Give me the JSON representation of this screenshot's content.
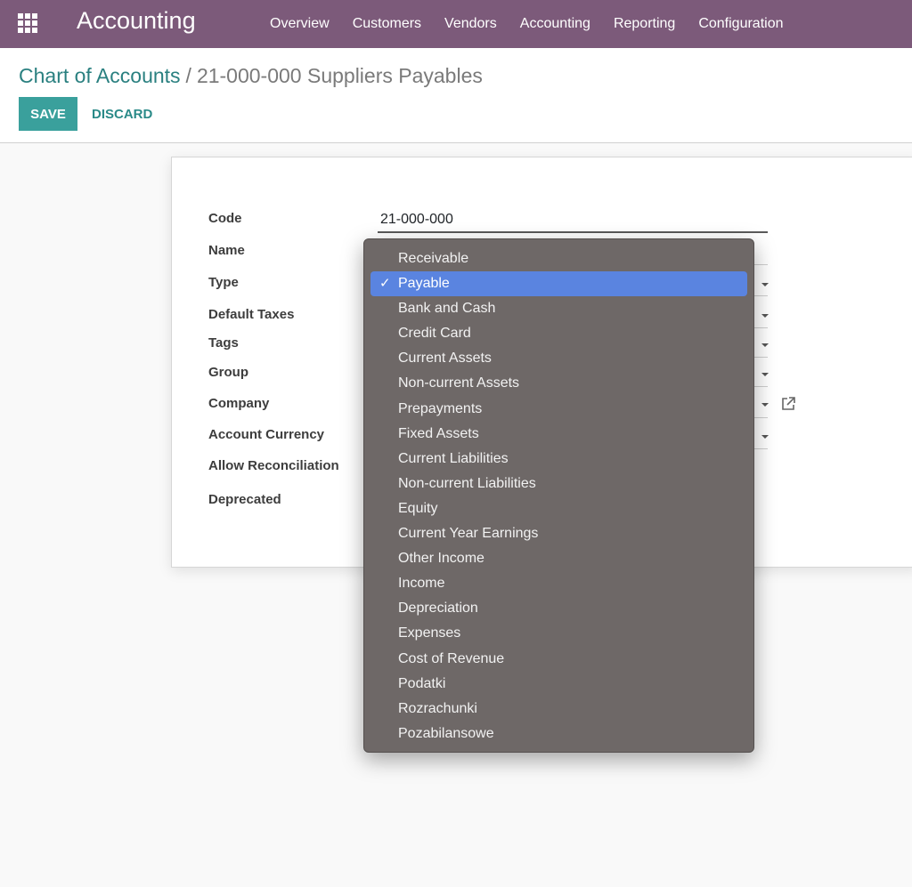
{
  "navbar": {
    "brand": "Accounting",
    "menu": [
      "Overview",
      "Customers",
      "Vendors",
      "Accounting",
      "Reporting",
      "Configuration"
    ]
  },
  "breadcrumb": {
    "parent": "Chart of Accounts",
    "separator": "/",
    "current": "21-000-000 Suppliers Payables"
  },
  "buttons": {
    "save": "SAVE",
    "discard": "DISCARD"
  },
  "form": {
    "labels": {
      "code": "Code",
      "name": "Name",
      "type": "Type",
      "default_taxes": "Default Taxes",
      "tags": "Tags",
      "group": "Group",
      "company": "Company",
      "account_currency": "Account Currency",
      "allow_reconciliation": "Allow Reconciliation",
      "deprecated": "Deprecated"
    },
    "code_value": "21-000-000"
  },
  "dropdown": {
    "selected_index": 1,
    "check_glyph": "✓",
    "options": [
      "Receivable",
      "Payable",
      "Bank and Cash",
      "Credit Card",
      "Current Assets",
      "Non-current Assets",
      "Prepayments",
      "Fixed Assets",
      "Current Liabilities",
      "Non-current Liabilities",
      "Equity",
      "Current Year Earnings",
      "Other Income",
      "Income",
      "Depreciation",
      "Expenses",
      "Cost of Revenue",
      "Podatki",
      "Rozrachunki",
      "Pozabilansowe"
    ]
  },
  "icons": {
    "apps": "apps-grid-icon",
    "external_link": "external-link-icon",
    "caret": "caret-down-icon",
    "check": "check-icon"
  },
  "colors": {
    "navbar": "#7c5a7a",
    "primary": "#3aa09c",
    "link": "#2a8080",
    "dropdown_bg": "#6e6867",
    "dropdown_selected": "#5a84e0"
  }
}
